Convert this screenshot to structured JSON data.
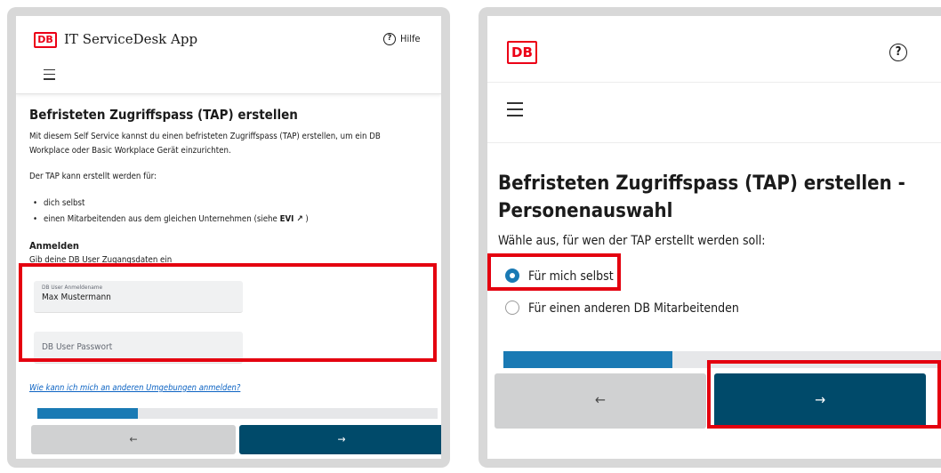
{
  "left_screen": {
    "logo_text": "DB",
    "app_title": "IT ServiceDesk App",
    "help_label": "Hilfe",
    "page_title": "Befristeten Zugriffspass (TAP) erstellen",
    "intro_line1": "Mit diesem Self Service kannst du einen befristeten Zugriffspass (TAP) erstellen, um ein DB",
    "intro_line2": "Workplace oder Basic Workplace Gerät einzurichten.",
    "for_whom": "Der TAP kann erstellt werden für:",
    "bullet1": "dich selbst",
    "bullet2_prefix": "einen Mitarbeitenden aus dem gleichen Unternehmen (siehe ",
    "bullet2_link": "EVI",
    "bullet2_suffix": " )",
    "login_heading": "Anmelden",
    "login_hint": "Gib deine DB User Zugangsdaten ein",
    "username_label": "DB User Anmeldename",
    "username_value": "Max Mustermann",
    "password_placeholder": "DB User Passwort",
    "env_link": "Wie kann ich mich an anderen Umgebungen anmelden?",
    "progress": 0.25,
    "back_symbol": "←",
    "next_symbol": "→"
  },
  "right_screen": {
    "logo_text": "DB",
    "page_title": "Befristeten Zugriffspass (TAP) erstellen - Personenauswahl",
    "question": "Wähle aus, für wen der TAP erstellt werden soll:",
    "options": [
      {
        "label": "Für mich selbst",
        "selected": true
      },
      {
        "label": "Für einen anderen DB Mitarbeitenden",
        "selected": false
      }
    ],
    "progress": 0.38,
    "back_symbol": "←",
    "next_symbol": "→"
  },
  "colors": {
    "db_red": "#ec0016",
    "highlight_red": "#e4000f",
    "primary_button": "#004a6a",
    "progress_fill": "#1a7ab4",
    "secondary_button": "#d0d1d2"
  }
}
